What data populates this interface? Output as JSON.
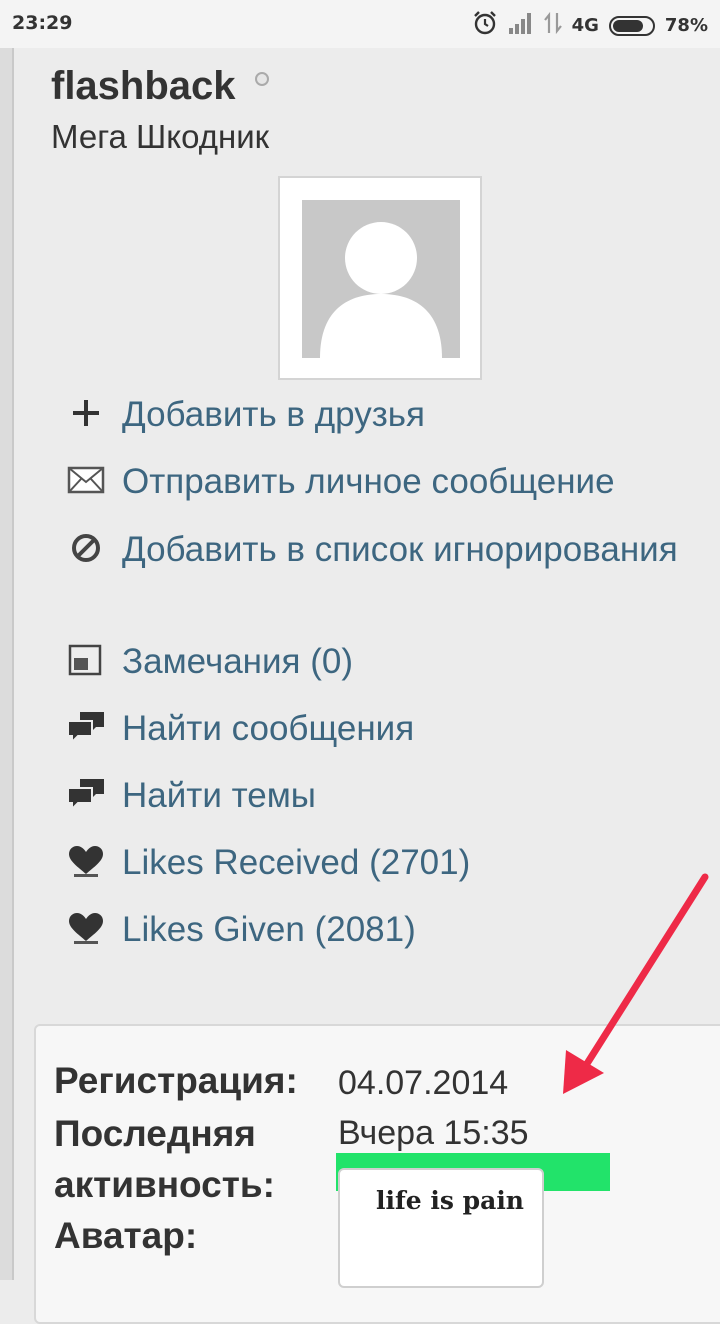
{
  "status_bar": {
    "time": "23:29",
    "network": "4G",
    "battery": "78%",
    "battery_level": 0.78,
    "icons": [
      "alarm-icon",
      "signal-icon",
      "data-transfer-icon",
      "battery-icon"
    ]
  },
  "profile": {
    "username": "flashback",
    "user_title": "Мега Шкодник",
    "status": "offline"
  },
  "actions": [
    {
      "label": "Добавить в друзья",
      "icon": "plus-icon"
    },
    {
      "label": "Отправить личное сообщение",
      "icon": "envelope-icon"
    },
    {
      "label": "Добавить в список игнорирования",
      "icon": "block-icon"
    },
    {
      "label": "Замечания (0)",
      "icon": "warning-note-icon"
    },
    {
      "label": "Найти сообщения",
      "icon": "chat-bubbles-icon"
    },
    {
      "label": "Найти темы",
      "icon": "chat-bubbles-icon"
    },
    {
      "label": "Likes Received (2701)",
      "icon": "heart-icon"
    },
    {
      "label": "Likes Given (2081)",
      "icon": "heart-icon"
    }
  ],
  "info": {
    "registration_label": "Регистрация:",
    "registration_value": "04.07.2014",
    "last_activity_label_line1": "Последняя",
    "last_activity_label_line2": "активность:",
    "last_activity_value": "Вчера 15:35",
    "avatar_label": "Аватар:",
    "signature_text": "life is pain"
  },
  "colors": {
    "link": "#3d6680",
    "highlight_bar": "#22e36a",
    "arrow": "#ee2a47"
  }
}
